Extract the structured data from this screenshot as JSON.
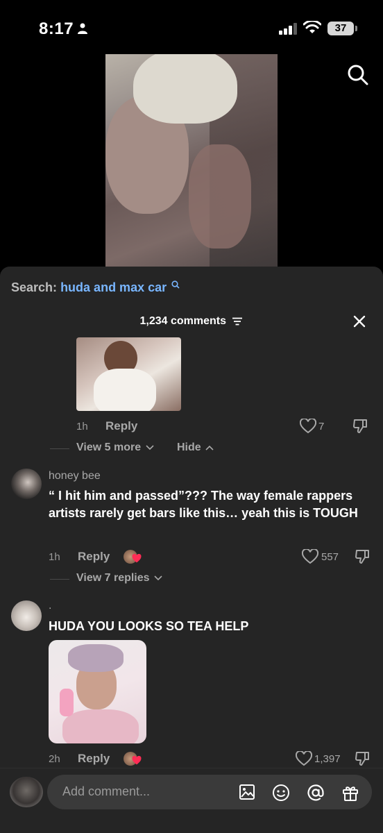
{
  "status_bar": {
    "time": "8:17",
    "battery": "37"
  },
  "search": {
    "label": "Search:",
    "query": "huda and max car"
  },
  "comments_header": {
    "count": "1,234 comments"
  },
  "reply_thread": {
    "time": "1h",
    "reply_label": "Reply",
    "likes": "7",
    "view_more": "View 5 more",
    "hide": "Hide"
  },
  "comments": [
    {
      "username": "honey bee",
      "text": "“ I hit him and passed”??? The way female rappers artists rarely get bars like this… yeah this is TOUGH",
      "time": "1h",
      "reply_label": "Reply",
      "likes": "557",
      "view_replies": "View 7 replies"
    },
    {
      "username": ".",
      "text": "HUDA YOU LOOKS SO TEA HELP",
      "time": "2h",
      "reply_label": "Reply",
      "likes": "1,397"
    }
  ],
  "composer": {
    "placeholder": "Add comment..."
  },
  "icons": {
    "status": [
      "person-icon",
      "signal-icon",
      "wifi-icon"
    ],
    "composer": [
      "image-icon",
      "emoji-icon",
      "mention-icon",
      "gift-icon"
    ]
  }
}
